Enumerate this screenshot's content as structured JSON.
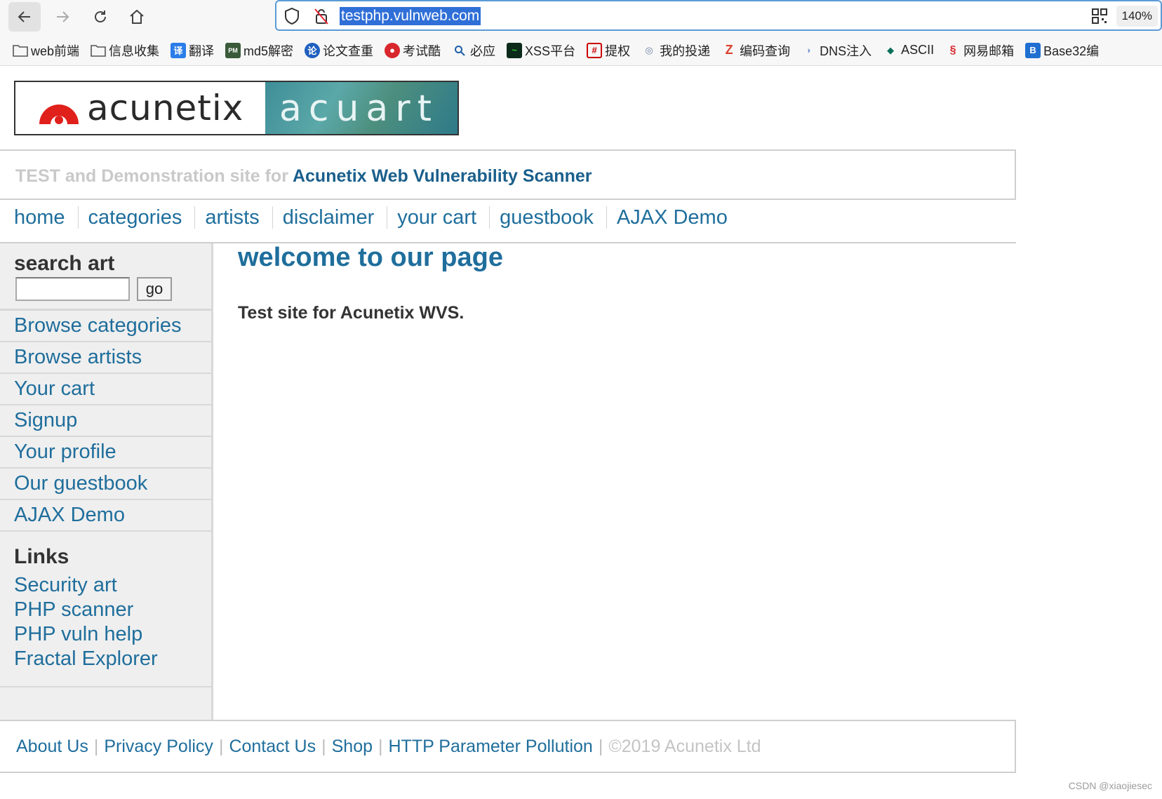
{
  "browser": {
    "url": "testphp.vulnweb.com",
    "zoom": "140%",
    "bookmarks": [
      {
        "label": "web前端",
        "icon": "folder-icon"
      },
      {
        "label": "信息收集",
        "icon": "folder-icon"
      },
      {
        "label": "翻译",
        "icon": "translate-icon"
      },
      {
        "label": "md5解密",
        "icon": "md5-icon"
      },
      {
        "label": "论文查重",
        "icon": "paper-check-icon"
      },
      {
        "label": "考试酷",
        "icon": "exam-icon"
      },
      {
        "label": "必应",
        "icon": "search-icon"
      },
      {
        "label": "XSS平台",
        "icon": "xss-icon"
      },
      {
        "label": "提权",
        "icon": "grid-icon"
      },
      {
        "label": "我的投递",
        "icon": "mail-eye-icon"
      },
      {
        "label": "编码查询",
        "icon": "z-icon"
      },
      {
        "label": "DNS注入",
        "icon": "dns-icon"
      },
      {
        "label": "ASCII",
        "icon": "ascii-icon"
      },
      {
        "label": "网易邮箱",
        "icon": "netease-icon"
      },
      {
        "label": "Base32编",
        "icon": "b-icon"
      }
    ]
  },
  "site": {
    "logo_left": "acunetix",
    "logo_right": "acuart",
    "tagline_prefix": "TEST and Demonstration site for",
    "tagline_brand": "Acunetix Web Vulnerability Scanner",
    "nav": [
      "home",
      "categories",
      "artists",
      "disclaimer",
      "your cart",
      "guestbook",
      "AJAX Demo"
    ],
    "search": {
      "title": "search art",
      "value": "",
      "button": "go"
    },
    "menu": [
      "Browse categories",
      "Browse artists",
      "Your cart",
      "Signup",
      "Your profile",
      "Our guestbook",
      "AJAX Demo"
    ],
    "links_title": "Links",
    "links": [
      "Security art",
      "PHP scanner",
      "PHP vuln help",
      "Fractal Explorer"
    ],
    "main": {
      "title": "welcome to our page",
      "text": "Test site for Acunetix WVS."
    },
    "footer": {
      "links": [
        "About Us",
        "Privacy Policy",
        "Contact Us",
        "Shop",
        "HTTP Parameter Pollution"
      ],
      "copyright": "©2019 Acunetix Ltd"
    }
  },
  "watermark": "CSDN @xiaojiesec",
  "colors": {
    "link": "#1f6e9c",
    "sidebar_bg": "#efefef",
    "url_highlight": "#2f6fd7"
  }
}
